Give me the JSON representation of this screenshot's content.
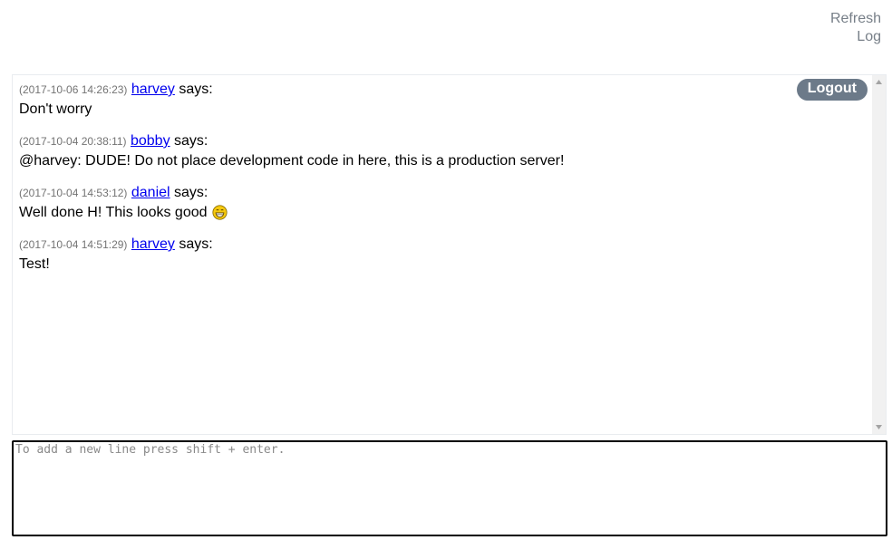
{
  "header": {
    "refresh_log_label": "Refresh Log"
  },
  "chat": {
    "logout_label": "Logout",
    "says_label": "says:",
    "messages": [
      {
        "timestamp": "(2017-10-06 14:26:23)",
        "user": "harvey",
        "text": "Don't worry",
        "emoji": null
      },
      {
        "timestamp": "(2017-10-04 20:38:11)",
        "user": "bobby",
        "text": "@harvey: DUDE! Do not place development code in here, this is a production server!",
        "emoji": null
      },
      {
        "timestamp": "(2017-10-04 14:53:12)",
        "user": "daniel",
        "text": "Well done H! This looks good",
        "emoji": "grinning-emoji-icon"
      },
      {
        "timestamp": "(2017-10-04 14:51:29)",
        "user": "harvey",
        "text": "Test!",
        "emoji": null
      }
    ]
  },
  "input": {
    "placeholder": "To add a new line press shift + enter.",
    "value": ""
  },
  "colors": {
    "logout_bg": "#6c7a89",
    "link": "#0000ee",
    "refresh_link": "#777f88"
  }
}
